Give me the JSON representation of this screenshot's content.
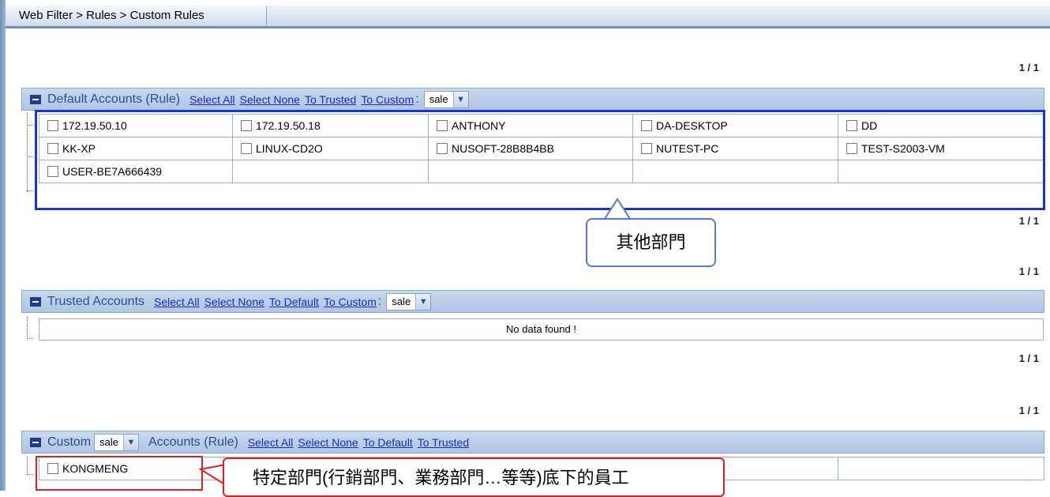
{
  "breadcrumb": "Web Filter > Rules > Custom Rules",
  "pagers": [
    "1 / 1",
    "1 / 1",
    "1 / 1",
    "1 / 1",
    "1 / 1"
  ],
  "default_section": {
    "title": "Default  Accounts (Rule)",
    "links": [
      "Select All",
      "Select None",
      "To Trusted",
      "To Custom"
    ],
    "colon": ":",
    "select_value": "sale",
    "rows": [
      [
        "172.19.50.10",
        "172.19.50.18",
        "ANTHONY",
        "DA-DESKTOP",
        "DD"
      ],
      [
        "KK-XP",
        "LINUX-CD2O",
        "NUSOFT-28B8B4BB",
        "NUTEST-PC",
        "TEST-S2003-VM"
      ],
      [
        "USER-BE7A666439",
        "",
        "",
        "",
        ""
      ]
    ]
  },
  "trusted_section": {
    "title": "Trusted  Accounts",
    "links": [
      "Select All",
      "Select None",
      "To Default",
      "To Custom"
    ],
    "colon": ":",
    "select_value": "sale",
    "empty_text": "No data found !"
  },
  "custom_section": {
    "title_prefix": "Custom",
    "select_value": "sale",
    "title_suffix": "Accounts (Rule)",
    "links": [
      "Select All",
      "Select None",
      "To Default",
      "To Trusted"
    ],
    "rows": [
      [
        "KONGMENG",
        "",
        "",
        "",
        ""
      ]
    ]
  },
  "annotations": {
    "blue_callout": "其他部門",
    "red_callout": "特定部門(行銷部門、業務部門…等等)底下的員工"
  },
  "colors": {
    "header_bg": "#b6cbe8",
    "link": "#1a2fb8",
    "annot_blue": "#1838c0",
    "annot_red": "#e02020"
  }
}
